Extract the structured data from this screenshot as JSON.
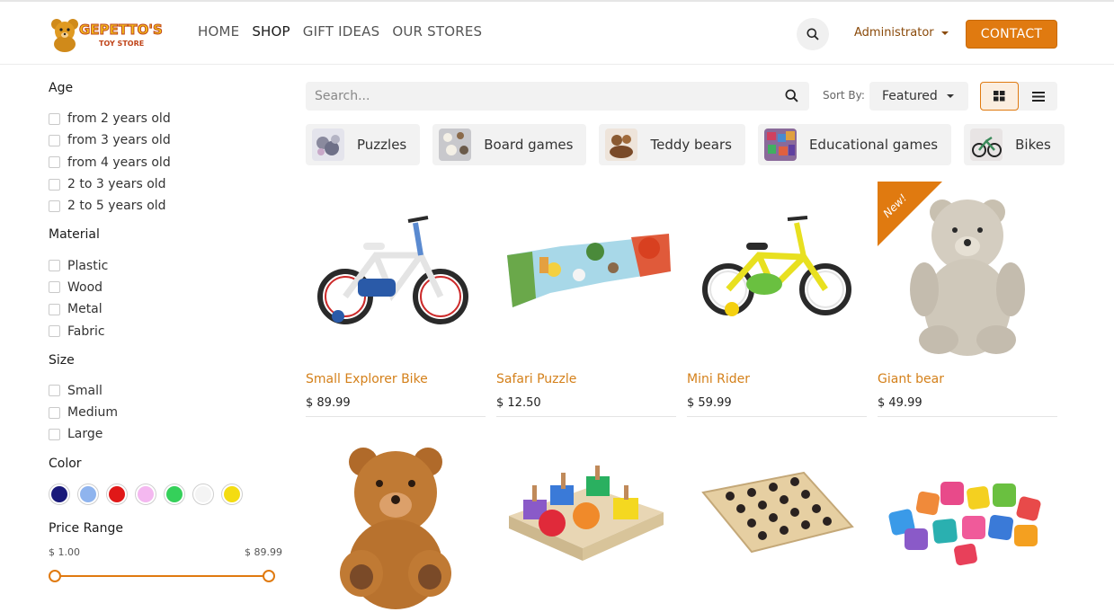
{
  "header": {
    "logo_title": "GEPETTO'S",
    "logo_subtitle": "TOY STORE",
    "nav": [
      "HOME",
      "SHOP",
      "GIFT IDEAS",
      "OUR STORES"
    ],
    "active_nav": "SHOP",
    "user": "Administrator",
    "contact": "CONTACT"
  },
  "filters": {
    "age": {
      "title": "Age",
      "options": [
        "from 2 years old",
        "from 3 years old",
        "from 4 years old",
        "2 to 3 years old",
        "2 to 5 years old"
      ]
    },
    "material": {
      "title": "Material",
      "options": [
        "Plastic",
        "Wood",
        "Metal",
        "Fabric"
      ]
    },
    "size": {
      "title": "Size",
      "options": [
        "Small",
        "Medium",
        "Large"
      ]
    },
    "color": {
      "title": "Color",
      "swatches": [
        "#1a1a7a",
        "#8fb4ee",
        "#e01818",
        "#f4b8f0",
        "#35d05a",
        "#f4f4f4",
        "#f4dc12"
      ]
    },
    "price": {
      "title": "Price Range",
      "min": "$ 1.00",
      "max": "$ 89.99"
    }
  },
  "toolbar": {
    "search_placeholder": "Search...",
    "sort_label": "Sort By:",
    "sort_value": "Featured",
    "view": "grid"
  },
  "categories": [
    "Puzzles",
    "Board games",
    "Teddy bears",
    "Educational games",
    "Bikes"
  ],
  "products": [
    {
      "name": "Small Explorer Bike",
      "price": "$ 89.99"
    },
    {
      "name": "Safari Puzzle",
      "price": "$ 12.50"
    },
    {
      "name": "Mini Rider",
      "price": "$ 59.99"
    },
    {
      "name": "Giant bear",
      "price": "$ 49.99",
      "badge": "New!"
    }
  ],
  "colors": {
    "accent": "#e07a10",
    "product_name": "#d4801a",
    "admin": "#8a4a0a"
  }
}
